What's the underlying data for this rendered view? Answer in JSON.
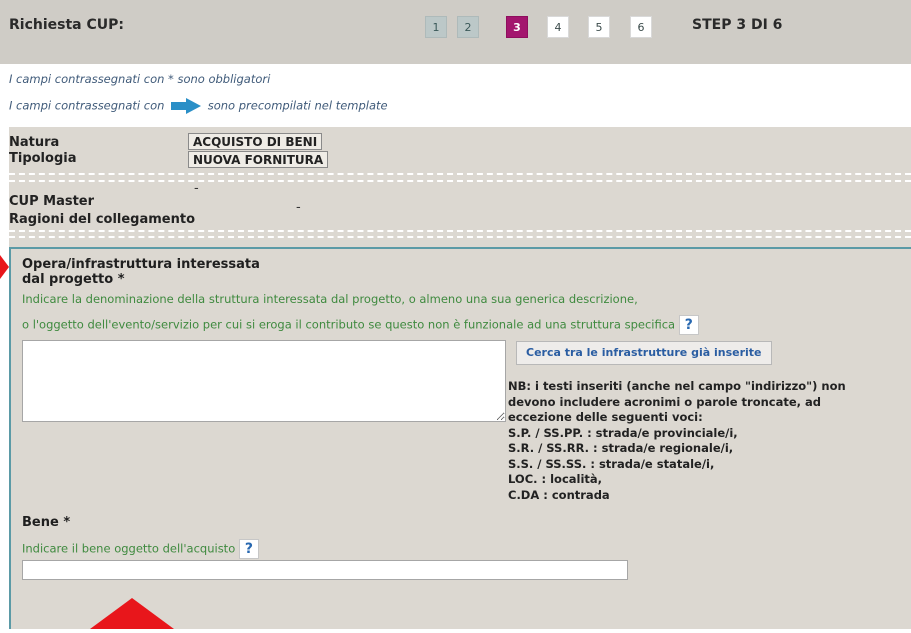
{
  "header": {
    "title": "Richiesta CUP:",
    "steps": [
      "1",
      "2",
      "3",
      "4",
      "5",
      "6"
    ],
    "active_step": "3",
    "step_label": "STEP 3 DI 6"
  },
  "notes": {
    "required": "I campi contrassegnati con * sono obbligatori",
    "prefilled_before": "I campi contrassegnati con",
    "prefilled_after": "sono precompilati nel template"
  },
  "summary": {
    "natura_label": "Natura",
    "natura_value": "ACQUISTO DI BENI",
    "tipologia_label": "Tipologia",
    "tipologia_value": "NUOVA FORNITURA",
    "cup_master_label": "CUP Master",
    "cup_master_value": "-",
    "ragioni_label": "Ragioni del collegamento",
    "ragioni_value": "-"
  },
  "opera": {
    "label_line1": "Opera/infrastruttura interessata",
    "label_line2": "dal progetto *",
    "hint1": "Indicare la denominazione della struttura interessata dal progetto, o almeno una sua generica descrizione,",
    "hint2": "o l'oggetto dell'evento/servizio per cui si eroga il contributo se questo non è funzionale ad una struttura specifica",
    "help": "?",
    "search_button": "Cerca tra le infrastrutture già inserite",
    "nb_lines": [
      "NB: i testi inseriti (anche nel campo \"indirizzo\") non",
      "devono includere acronimi o parole troncate, ad",
      "eccezione delle seguenti voci:",
      "S.P. / SS.PP. : strada/e provinciale/i,",
      "S.R. / SS.RR. : strada/e regionale/i,",
      "S.S. / SS.SS. : strada/e statale/i,",
      "LOC. : località,",
      "C.DA : contrada"
    ]
  },
  "bene": {
    "label": "Bene *",
    "hint": "Indicare il bene oggetto dell'acquisto",
    "help": "?"
  },
  "colors": {
    "active_step": "#a3156e",
    "section_border": "#5b9aa6",
    "annotation_arrow": "#e8161b",
    "hint_text": "#3f8a3f"
  }
}
